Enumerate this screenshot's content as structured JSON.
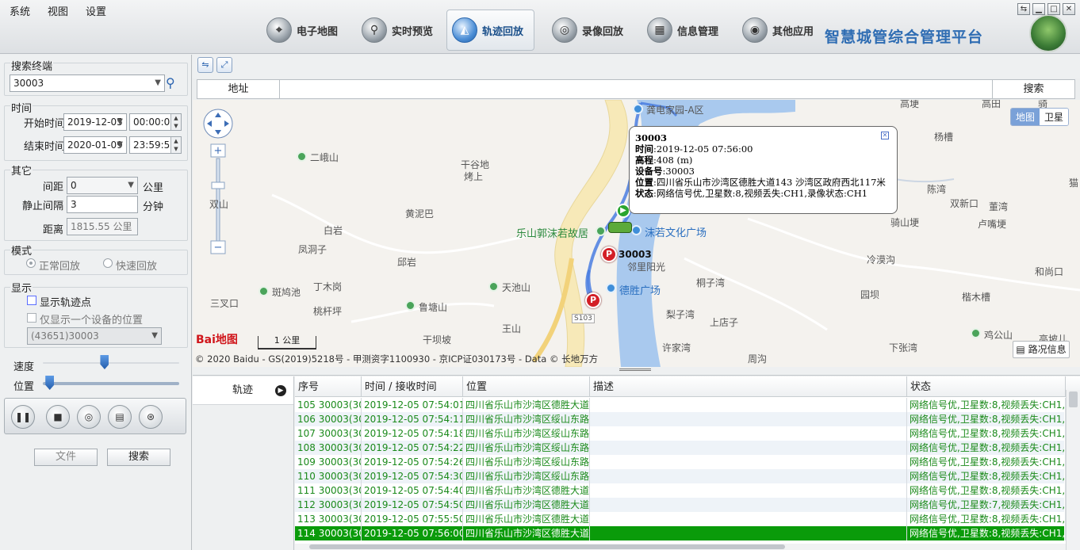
{
  "menu": [
    "系统",
    "视图",
    "设置"
  ],
  "nav": [
    {
      "label": "电子地图",
      "icon": "map-pin-icon"
    },
    {
      "label": "实时预览",
      "icon": "search-globe-icon"
    },
    {
      "label": "轨迹回放",
      "icon": "track-playback-icon",
      "active": true
    },
    {
      "label": "录像回放",
      "icon": "film-reel-icon"
    },
    {
      "label": "信息管理",
      "icon": "grid-info-icon"
    },
    {
      "label": "其他应用",
      "icon": "apps-disc-icon"
    }
  ],
  "app_title": "智慧城管综合管理平台",
  "left": {
    "search_label": "搜索终端",
    "terminal": "30003",
    "time_label": "时间",
    "start_label": "开始时间",
    "start_date": "2019-12-05",
    "start_time": "00:00:00",
    "end_label": "结束时间",
    "end_date": "2020-01-09",
    "end_time": "23:59:59",
    "other_label": "其它",
    "interval_label": "间距",
    "interval_value": "0",
    "interval_unit": "公里",
    "still_label": "静止间隔",
    "still_value": "3",
    "still_unit": "分钟",
    "distance_label": "距离",
    "distance_value": "1815.55 公里",
    "mode_label": "模式",
    "mode_normal": "正常回放",
    "mode_fast": "快速回放",
    "display_label": "显示",
    "show_points": "显示轨迹点",
    "show_one": "仅显示一个设备的位置",
    "device_select": "(43651)30003",
    "speed_label": "速度",
    "position_label": "位置",
    "speed_level": 0.45,
    "position_level": 0.02,
    "file_btn": "文件",
    "search_btn": "搜索"
  },
  "toolbar": {
    "addr_label": "地址",
    "search_label": "搜索"
  },
  "map": {
    "places": {
      "p1": "龚电家园-A区",
      "p2": "二峨山",
      "p3": "干谷地",
      "p4": "烤上",
      "p5": "黄泥巴",
      "p6": "白岩",
      "p7": "凤洞子",
      "p8": "邱岩",
      "p9": "丁木岗",
      "p10": "斑鸠池",
      "p11": "三叉口",
      "p12": "桃杆坪",
      "p13": "鲁塘山",
      "p14": "天池山",
      "p15": "王山",
      "p16": "干坝坡",
      "p17": "乐山郭沫若故居",
      "p18": "沫若文化广场",
      "p19": "邻里阳光",
      "p20": "德胜广场",
      "p21": "桐子湾",
      "p22": "梨子湾",
      "p23": "上店子",
      "p24": "许家湾",
      "p25": "杨槽",
      "p26": "陈湾",
      "p27": "双新口",
      "p28": "董湾",
      "p29": "卢嘴埂",
      "p30": "骑山埂",
      "p31": "冷漠沟",
      "p32": "园坝",
      "p33": "楷木槽",
      "p34": "下张湾",
      "p35": "周沟",
      "p36": "鸡公山",
      "p37": "高坡儿",
      "p38": "和尚口",
      "p39": "高埂",
      "p40": "S103",
      "p41": "30003",
      "p42": "猫",
      "p43": "双山",
      "p44": "骑",
      "p45": "高田"
    },
    "popup": {
      "title": "30003",
      "time_k": "时间",
      "time_v": "2019-12-05 07:56:00",
      "alt_k": "高程",
      "alt_v": "408 (m)",
      "dev_k": "设备号",
      "dev_v": "30003",
      "pos_k": "位置",
      "pos_v": "四川省乐山市沙湾区德胜大道143 沙湾区政府西北117米",
      "status_k": "状态",
      "status_v": "网络信号优,卫星数:8,视频丢失:CH1,录像状态:CH1"
    },
    "map_type": [
      "地图",
      "卫星"
    ],
    "traffic": "路况信息",
    "baidu": "Bai地图",
    "scale": "1 公里",
    "copyright": "© 2020 Baidu - GS(2019)5218号 - 甲测资字1100930 - 京ICP证030173号 - Data © 长地万方"
  },
  "tracks_label": "轨迹",
  "grid": {
    "columns": [
      "序号",
      "时间 / 接收时间",
      "位置",
      "描述",
      "状态"
    ],
    "rows": [
      {
        "id": "105 30003(300",
        "time": "2019-12-05 07:54:01",
        "pos": "四川省乐山市沙湾区德胜大道",
        "desc": "",
        "status": "网络信号优,卫星数:8,视频丢失:CH1,录"
      },
      {
        "id": "106 30003(300",
        "time": "2019-12-05 07:54:11",
        "pos": "四川省乐山市沙湾区绥山东路",
        "desc": "",
        "status": "网络信号优,卫星数:8,视频丢失:CH1,录"
      },
      {
        "id": "107 30003(300",
        "time": "2019-12-05 07:54:18",
        "pos": "四川省乐山市沙湾区绥山东路",
        "desc": "",
        "status": "网络信号优,卫星数:8,视频丢失:CH1,录"
      },
      {
        "id": "108 30003(300",
        "time": "2019-12-05 07:54:22",
        "pos": "四川省乐山市沙湾区绥山东路",
        "desc": "",
        "status": "网络信号优,卫星数:8,视频丢失:CH1,录"
      },
      {
        "id": "109 30003(300",
        "time": "2019-12-05 07:54:26",
        "pos": "四川省乐山市沙湾区绥山东路",
        "desc": "",
        "status": "网络信号优,卫星数:8,视频丢失:CH1,录"
      },
      {
        "id": "110 30003(300",
        "time": "2019-12-05 07:54:30",
        "pos": "四川省乐山市沙湾区绥山东路",
        "desc": "",
        "status": "网络信号优,卫星数:8,视频丢失:CH1,录"
      },
      {
        "id": "111 30003(300",
        "time": "2019-12-05 07:54:40",
        "pos": "四川省乐山市沙湾区德胜大道",
        "desc": "",
        "status": "网络信号优,卫星数:8,视频丢失:CH1,录"
      },
      {
        "id": "112 30003(300",
        "time": "2019-12-05 07:54:50",
        "pos": "四川省乐山市沙湾区德胜大道",
        "desc": "",
        "status": "网络信号优,卫星数:7,视频丢失:CH1,录"
      },
      {
        "id": "113 30003(300",
        "time": "2019-12-05 07:55:50",
        "pos": "四川省乐山市沙湾区德胜大道",
        "desc": "",
        "status": "网络信号优,卫星数:8,视频丢失:CH1,录"
      },
      {
        "id": "114 30003(300",
        "time": "2019-12-05 07:56:00",
        "pos": "四川省乐山市沙湾区德胜大道",
        "desc": "",
        "status": "网络信号优,卫星数:8,视频丢失:CH1,录",
        "selected": true
      }
    ]
  }
}
